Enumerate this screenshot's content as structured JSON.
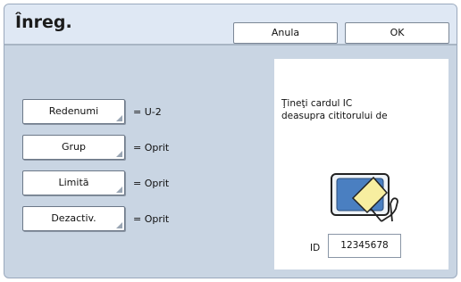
{
  "header": {
    "title": "Înreg.",
    "cancel_label": "Anula",
    "ok_label": "OK"
  },
  "settings": [
    {
      "label": "Redenumi",
      "value": "= U-2"
    },
    {
      "label": "Grup",
      "value": "= Oprit"
    },
    {
      "label": "Limită",
      "value": "= Oprit"
    },
    {
      "label": "Dezactiv.",
      "value": "= Oprit"
    }
  ],
  "card_panel": {
    "message_line1": "Ţineţi cardul IC",
    "message_line2": "deasupra cititorului de",
    "id_label": "ID",
    "id_value": "12345678"
  }
}
